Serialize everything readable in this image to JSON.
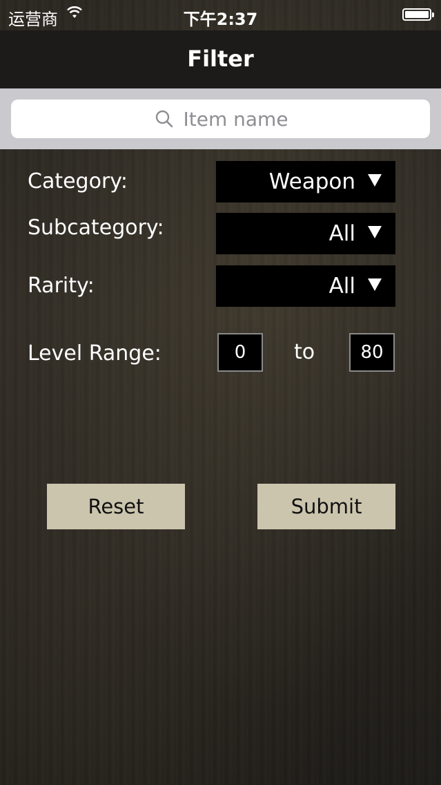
{
  "status_bar": {
    "carrier": "运营商",
    "time": "下午2:37",
    "battery_level": 1.0
  },
  "nav": {
    "title": "Filter"
  },
  "search": {
    "placeholder": "Item name"
  },
  "filters": {
    "category_label": "Category:",
    "category_value": "Weapon",
    "subcategory_label": "Subcategory:",
    "subcategory_value": "All",
    "rarity_label": "Rarity:",
    "rarity_value": "All",
    "level_range_label": "Level Range:",
    "level_min": "0",
    "level_to": "to",
    "level_max": "80"
  },
  "buttons": {
    "reset": "Reset",
    "submit": "Submit"
  }
}
